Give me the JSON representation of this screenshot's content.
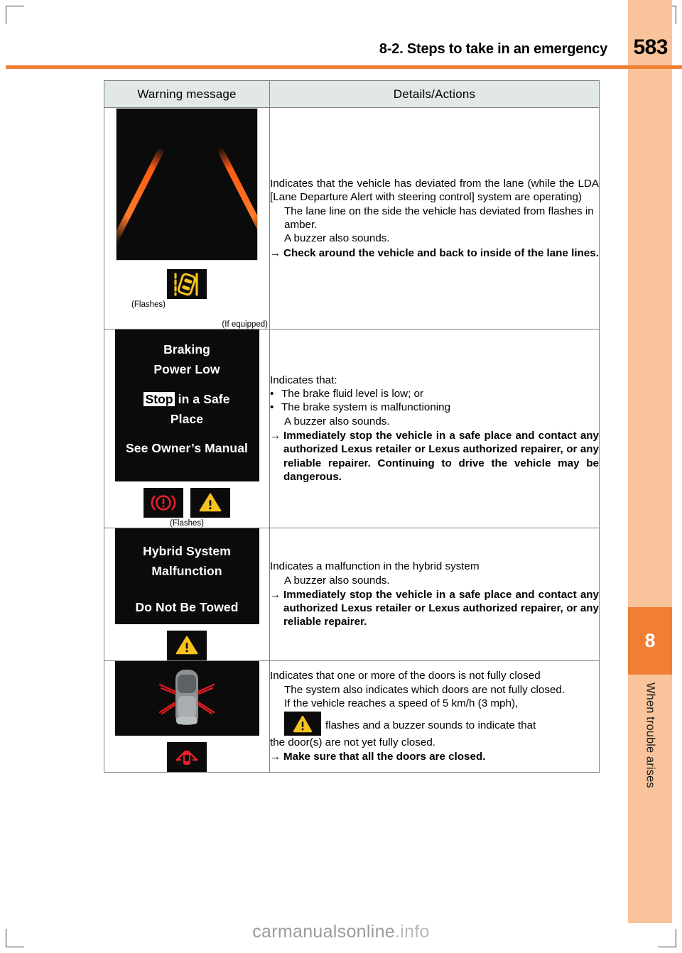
{
  "header": {
    "section_title": "8-2. Steps to take in an emergency",
    "page_number": "583",
    "rule_color": "#f07f35"
  },
  "sidebar": {
    "chapter_number": "8",
    "chapter_title": "When trouble arises",
    "block_color": "#f07f35",
    "band_color": "#f9c49b"
  },
  "table": {
    "columns": [
      "Warning message",
      "Details/Actions"
    ],
    "header_bg": "#e2e7e8",
    "rows": [
      {
        "id": "lane-departure",
        "display": {
          "type": "lane-lines",
          "caption_flashes": "(Flashes)",
          "caption_if_equipped": "(If equipped)",
          "icon": "lda-lane-departure-icon"
        },
        "details": {
          "intro": "Indicates that the vehicle has deviated from the lane (while the LDA [Lane Departure Alert with steering control] system are operating)",
          "sub": [
            "The lane line on the side the vehicle has deviated from flashes in amber.",
            "A buzzer also sounds."
          ],
          "arrow_symbol": "→",
          "action": "Check around the vehicle and back to inside of the lane lines."
        }
      },
      {
        "id": "braking-power-low",
        "display": {
          "type": "message",
          "lines": [
            "Braking",
            "Power Low"
          ],
          "lines2_prefix": "Stop",
          "lines2_rest": " in a Safe",
          "lines2_b": "Place",
          "lines3": "See Owner’s Manual",
          "icons": [
            "brake-warning-icon",
            "master-warning-icon"
          ],
          "caption_flashes": "(Flashes)"
        },
        "details": {
          "intro": "Indicates that:",
          "bullets": [
            "The brake fluid level is low; or",
            "The brake system is malfunctioning"
          ],
          "sub": [
            "A buzzer also sounds."
          ],
          "arrow_symbol": "→",
          "action": "Immediately stop the vehicle in a safe place and contact any authorized Lexus retailer or Lexus authorized repairer, or any reliable repairer. Continuing to drive the vehicle may be dangerous."
        }
      },
      {
        "id": "hybrid-system-malfunction",
        "display": {
          "type": "message",
          "lines": [
            "Hybrid System",
            "Malfunction"
          ],
          "lines3": "Do Not Be Towed",
          "icons": [
            "master-warning-icon"
          ]
        },
        "details": {
          "intro": "Indicates a malfunction in the hybrid system",
          "sub": [
            "A buzzer also sounds."
          ],
          "arrow_symbol": "→",
          "action": "Immediately stop the vehicle in a safe place and contact any authorized Lexus retailer or Lexus authorized repairer, or any reliable repairer."
        }
      },
      {
        "id": "door-ajar",
        "display": {
          "type": "car-doors-open",
          "icon": "door-open-warning-icon"
        },
        "details": {
          "intro": "Indicates that one or more of the doors is not fully closed",
          "sub": [
            "The system also indicates which doors are not fully closed."
          ],
          "speed_line": "If the vehicle reaches a speed of 5 km/h (3 mph),",
          "inline_icon": "master-warning-icon",
          "after_icon": "flashes and a buzzer sounds to indicate that",
          "after_icon2": "the door(s) are not yet fully closed.",
          "arrow_symbol": "→",
          "action": "Make sure that all the doors are closed."
        }
      }
    ]
  },
  "watermark": {
    "text_main": "carmanualsonline",
    "text_dim": ".info"
  }
}
